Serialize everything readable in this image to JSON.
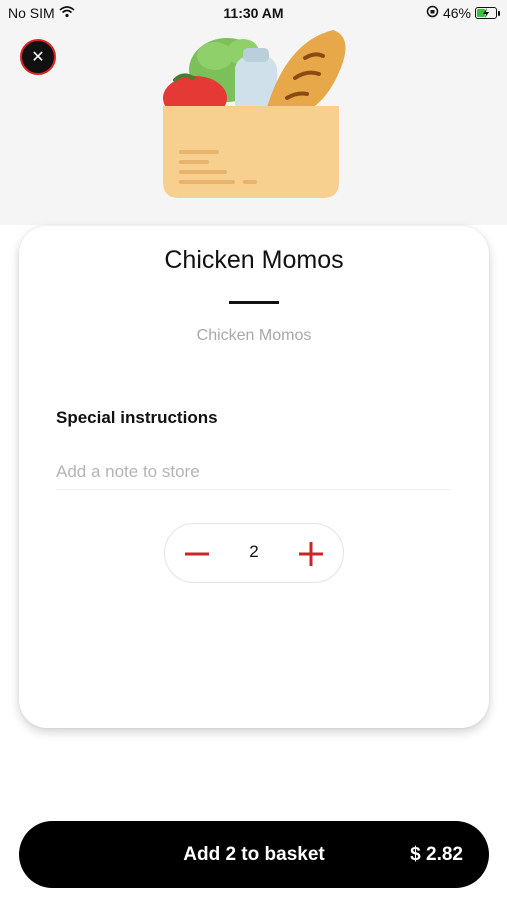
{
  "status_bar": {
    "carrier": "No SIM",
    "time": "11:30 AM",
    "battery": "46%",
    "battery_level": 0.46
  },
  "icons": {
    "close": "close-icon",
    "wifi": "wifi-icon",
    "orientation_lock": "orientation-lock-icon",
    "battery": "battery-icon",
    "hero": "grocery-bag-icon",
    "minus": "minus-icon",
    "plus": "plus-icon"
  },
  "item": {
    "title": "Chicken Momos",
    "description": "Chicken Momos"
  },
  "instructions": {
    "label": "Special instructions",
    "placeholder": "Add a note to store",
    "value": ""
  },
  "quantity": {
    "value": "2"
  },
  "basket_button": {
    "label": "Add 2 to basket",
    "price": "$ 2.82"
  },
  "colors": {
    "accent": "#c62828",
    "battery_fill": "#3cc13b",
    "button_bg": "#000000",
    "hero_bg": "#f5f5f5"
  }
}
